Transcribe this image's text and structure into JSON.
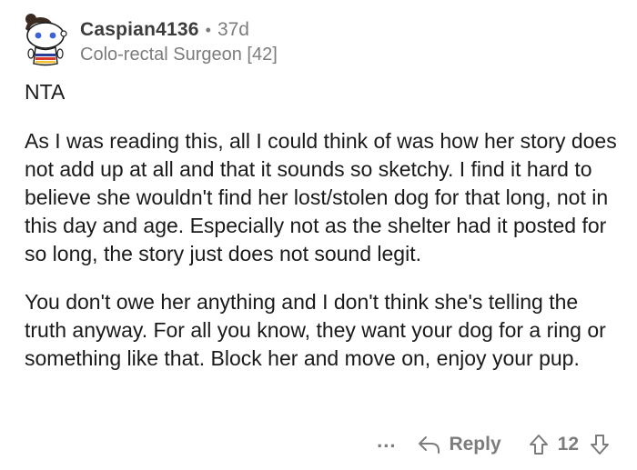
{
  "comment": {
    "author": "Caspian4136",
    "separator": "•",
    "age": "37d",
    "flair": "Colo-rectal Surgeon [42]",
    "paragraphs": [
      "NTA",
      "As I was reading this, all I could think of was how her story does not add up at all and that it sounds so sketchy. I find it hard to believe she wouldn't find her lost/stolen dog for that long, not in this day and age. Especially not as the shelter had it posted for so long, the story just does not sound legit.",
      "You don't owe her anything and I don't think she's telling the truth anyway. For all you know, they want your dog for a ring or something like that. Block her and move on, enjoy your pup."
    ]
  },
  "actions": {
    "more_label": "...",
    "reply_label": "Reply",
    "vote_count": "12"
  },
  "icons": {
    "avatar": "reddit-snoo-avatar-icon",
    "reply": "reply-arrow-icon",
    "upvote": "upvote-arrow-icon",
    "downvote": "downvote-arrow-icon"
  },
  "colors": {
    "text": "#1a1a1b",
    "meta": "#7c7c7c",
    "username": "#3c3c3c"
  }
}
